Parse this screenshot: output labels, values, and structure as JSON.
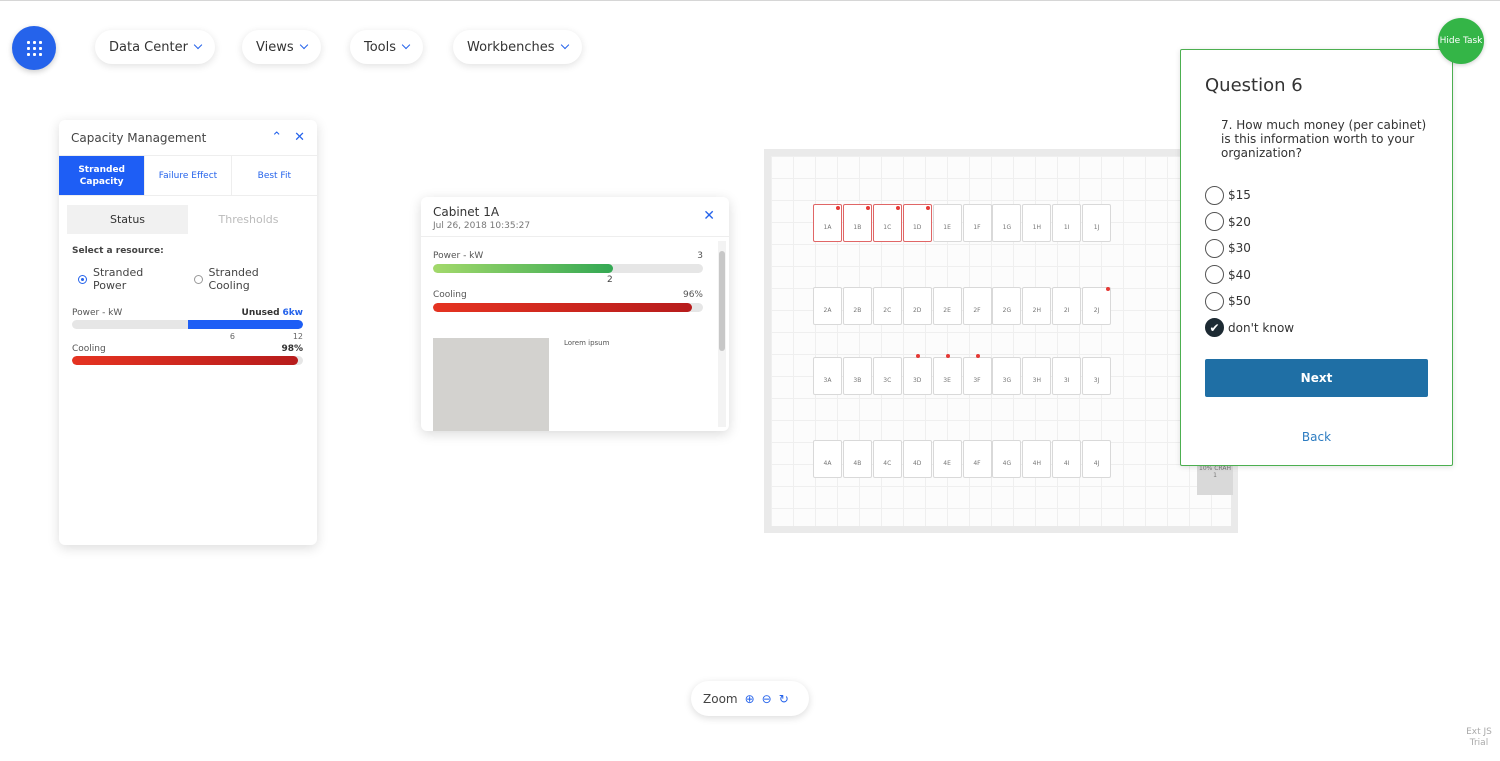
{
  "nav": {
    "menus": [
      "Data Center",
      "Views",
      "Tools",
      "Workbenches"
    ]
  },
  "capacity": {
    "title": "Capacity Management",
    "tabs": [
      "Stranded Capacity",
      "Failure Effect",
      "Best Fit"
    ],
    "segments": [
      "Status",
      "Thresholds"
    ],
    "select_label": "Select a resource:",
    "radios": [
      "Stranded Power",
      "Stranded Cooling"
    ],
    "power_label": "Power - kW",
    "power_unused_label": "Unused",
    "power_unused_value": "6kw",
    "power_used_fraction": 0.5,
    "tick_mid": "6",
    "tick_max": "12",
    "cooling_label": "Cooling",
    "cooling_value": "98%",
    "cooling_fraction": 0.98
  },
  "cabinet": {
    "title": "Cabinet 1A",
    "date": "Jul 26, 2018 10:35:27",
    "power_label": "Power - kW",
    "power_max": "3",
    "power_value": "2",
    "power_fraction": 0.667,
    "cooling_label": "Cooling",
    "cooling_value": "96%",
    "cooling_fraction": 0.96,
    "lorem": "Lorem ipsum"
  },
  "floor": {
    "rows": [
      [
        "1A",
        "1B",
        "1C",
        "1D",
        "1E",
        "1F",
        "1G",
        "1H",
        "1I",
        "1J"
      ],
      [
        "2A",
        "2B",
        "2C",
        "2D",
        "2E",
        "2F",
        "2G",
        "2H",
        "2I",
        "2J"
      ],
      [
        "3A",
        "3B",
        "3C",
        "3D",
        "3E",
        "3F",
        "3G",
        "3H",
        "3I",
        "3J"
      ],
      [
        "4A",
        "4B",
        "4C",
        "4D",
        "4E",
        "4F",
        "4G",
        "4H",
        "4I",
        "4J"
      ]
    ],
    "crac_label": "10% CRAH 1"
  },
  "question": {
    "title": "Question 6",
    "text": "7. How much money (per cabinet) is this information worth to your organization?",
    "options": [
      "$15",
      "$20",
      "$30",
      "$40",
      "$50",
      "don't know"
    ],
    "checked_index": 5,
    "next_label": "Next",
    "back_label": "Back",
    "hide_task_label": "Hide Task"
  },
  "zoom": {
    "label": "Zoom"
  },
  "watermark": "Ext JS Trial",
  "colors": {
    "accent": "#2563eb",
    "green": "#34b547",
    "red": "#e53935",
    "next": "#1f6fa5"
  }
}
